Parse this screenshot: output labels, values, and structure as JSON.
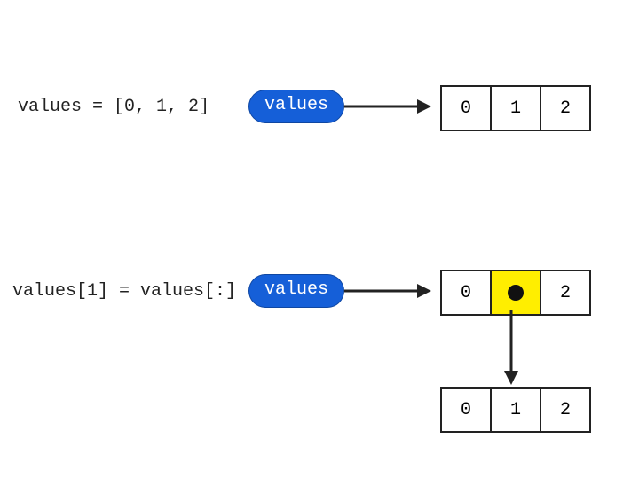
{
  "row1": {
    "code": "values = [0, 1, 2]",
    "pill": "values",
    "cells": [
      "0",
      "1",
      "2"
    ]
  },
  "row2": {
    "code": "values[1] = values[:]",
    "pill": "values",
    "cells": [
      "0",
      "",
      "2"
    ],
    "nested_cells": [
      "0",
      "1",
      "2"
    ]
  }
}
